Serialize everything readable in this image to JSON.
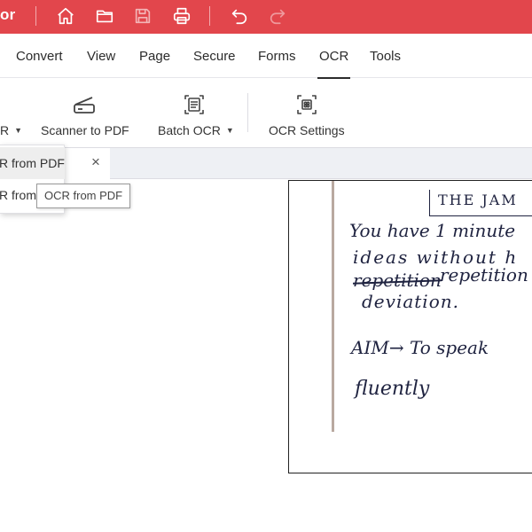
{
  "app": {
    "name_visible": "or",
    "accent_color": "#e2464c"
  },
  "titlebar": {
    "icons": [
      "home-icon",
      "folder-icon",
      "save-icon",
      "print-icon",
      "undo-icon",
      "redo-icon"
    ]
  },
  "menu": {
    "items": [
      "Convert",
      "View",
      "Page",
      "Secure",
      "Forms",
      "OCR",
      "Tools"
    ],
    "active": "OCR"
  },
  "ribbon": {
    "partial_label": "R",
    "scanner_label": "Scanner to PDF",
    "batch_label": "Batch OCR",
    "settings_label": "OCR Settings"
  },
  "tabs": {
    "close_symbol": "×"
  },
  "dropdown": {
    "items": [
      "OCR from PDF",
      "OCR from Image"
    ]
  },
  "tooltip": {
    "text": "OCR from PDF"
  },
  "document": {
    "lines": [
      "THE JAM",
      "You have 1 minute",
      "ideas without h",
      "repetition repetitio",
      "deviation.",
      "AIM→ To speak",
      "fluently"
    ],
    "struck_word": "repetition"
  }
}
